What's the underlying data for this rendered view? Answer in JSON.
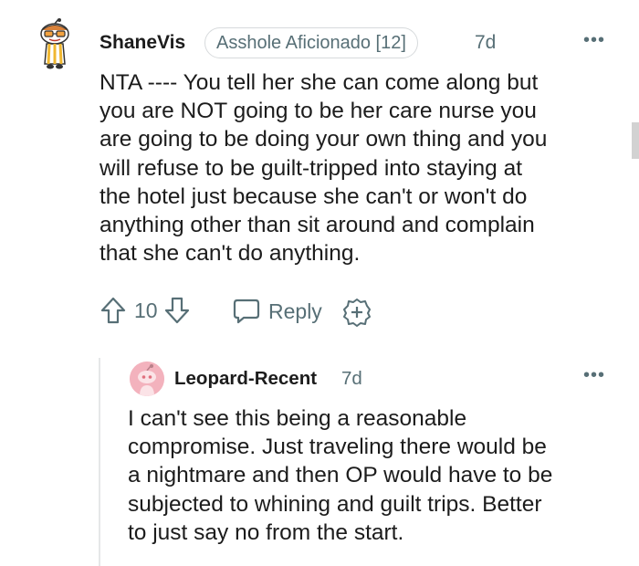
{
  "comment": {
    "username": "ShaneVis",
    "flair": "Asshole Aficionado [12]",
    "age": "7d",
    "more": "•••",
    "lines": [
      "NTA ---- You tell her she can come along but",
      "you are NOT going to be her care nurse you",
      "are going to be doing your own thing and you",
      "will refuse to be guilt-tripped into staying at",
      "the hotel just because she can't or won't do",
      "anything other than sit around and complain",
      "that she can't do anything."
    ],
    "vote_count": "10",
    "reply_label": "Reply",
    "icons": {
      "avatar": "snoo-avatar-icon",
      "upvote": "upvote-arrow-icon",
      "downvote": "downvote-arrow-icon",
      "reply": "speech-bubble-icon",
      "award": "award-plus-icon"
    }
  },
  "reply": {
    "username": "Leopard-Recent",
    "age": "7d",
    "more": "•••",
    "lines": [
      "I can't see this being a reasonable",
      "compromise. Just traveling there would be",
      "a nightmare and then OP would have to be",
      "subjected to whining and guilt trips. Better",
      "to just say no from the start."
    ]
  },
  "colors": {
    "text": "#1c1c1c",
    "meta": "#576f76",
    "border": "#d7dadc",
    "avatar2_bg": "#f3b2bd"
  }
}
